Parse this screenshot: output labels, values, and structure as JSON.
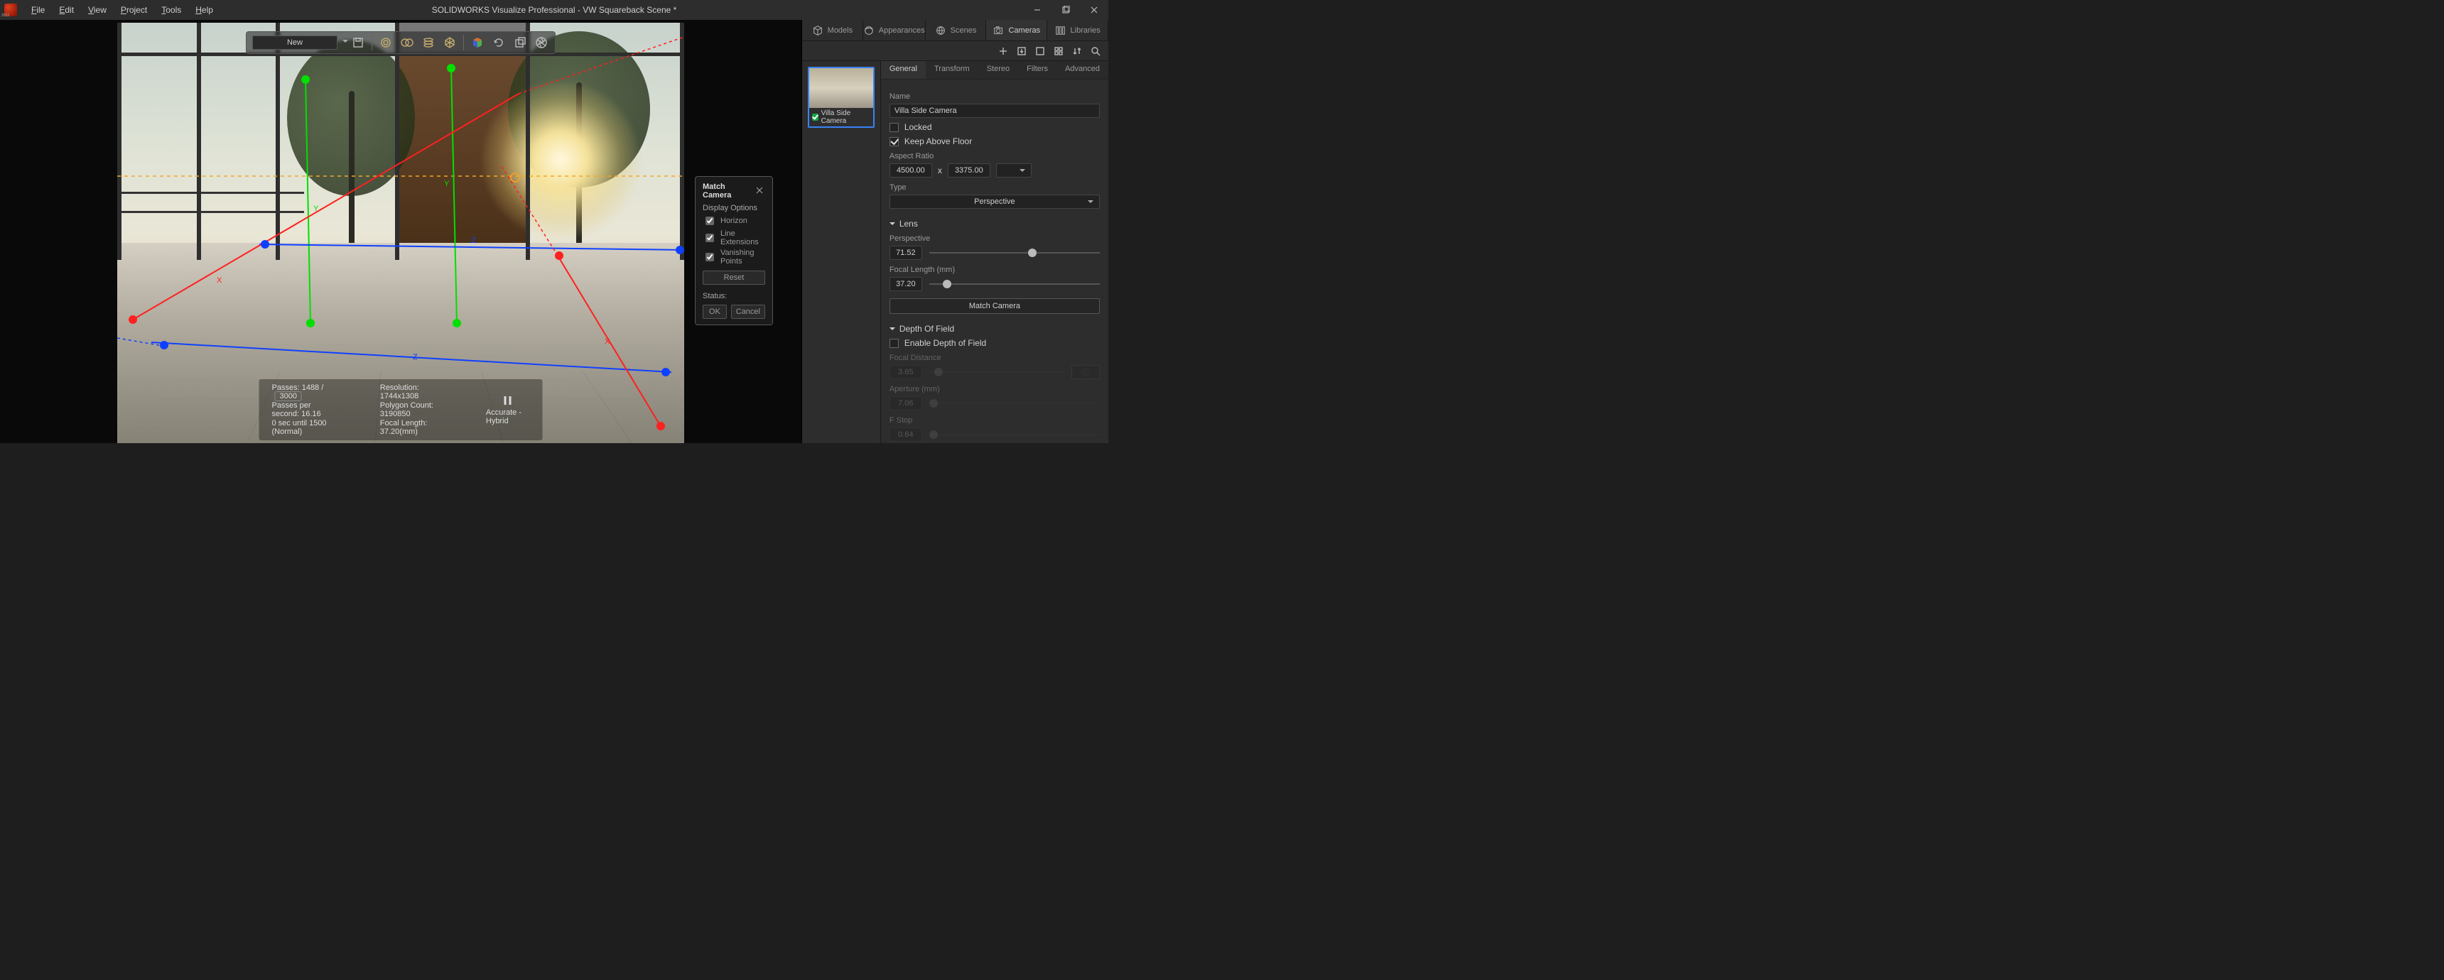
{
  "app_icon_year": "2022",
  "menu": {
    "file": "File",
    "edit": "Edit",
    "view": "View",
    "project": "Project",
    "tools": "Tools",
    "help": "Help"
  },
  "title": "SOLIDWORKS Visualize Professional - VW Squareback Scene *",
  "viewport_toolbar": {
    "camera_preset": "New"
  },
  "match_panel": {
    "title": "Match Camera",
    "display_options": "Display Options",
    "horizon": "Horizon",
    "horizon_on": true,
    "line_ext": "Line Extensions",
    "line_ext_on": true,
    "van_pts": "Vanishing Points",
    "van_pts_on": true,
    "reset": "Reset",
    "status_label": "Status:",
    "status_value": "",
    "ok": "OK",
    "cancel": "Cancel"
  },
  "hud": {
    "passes_label": "Passes:",
    "passes_cur": "1488",
    "passes_sep": "/",
    "passes_max": "3000",
    "pps_label": "Passes per second:",
    "pps_val": "16.16",
    "eta": "0 sec until 1500 (Normal)",
    "res_label": "Resolution:",
    "res_val": "1744x1308",
    "poly_label": "Polygon Count:",
    "poly_val": "3190850",
    "fl_label": "Focal Length:",
    "fl_val": "37.20(mm)",
    "mode": "Accurate - Hybrid"
  },
  "dock_tabs": {
    "models": "Models",
    "appearances": "Appearances",
    "scenes": "Scenes",
    "cameras": "Cameras",
    "libraries": "Libraries"
  },
  "thumb": {
    "name": "Villa Side Camera"
  },
  "prop_tabs": {
    "general": "General",
    "transform": "Transform",
    "stereo": "Stereo",
    "filters": "Filters",
    "advanced": "Advanced"
  },
  "general": {
    "name_label": "Name",
    "name_value": "Villa Side Camera",
    "locked": "Locked",
    "locked_on": false,
    "keep_above": "Keep Above Floor",
    "keep_above_on": true,
    "aspect_label": "Aspect Ratio",
    "aspect_w": "4500.00",
    "aspect_x": "x",
    "aspect_h": "3375.00",
    "type_label": "Type",
    "type_value": "Perspective",
    "lens_hd": "Lens",
    "persp_label": "Perspective",
    "persp_value": "71.52",
    "persp_slider": 0.58,
    "focal_label": "Focal Length (mm)",
    "focal_value": "37.20",
    "focal_slider": 0.08,
    "match_btn": "Match Camera",
    "dof_hd": "Depth Of Field",
    "dof_enable": "Enable Depth of Field",
    "dof_on": false,
    "fd_label": "Focal Distance",
    "fd_value": "3.65",
    "fd_slider": 0.04,
    "pick": "Pick",
    "ap_label": "Aperture (mm)",
    "ap_value": "7.06",
    "ap_slider": 0.0,
    "fstop_label": "F Stop",
    "fstop_value": "0.84",
    "fstop_slider": 0.0
  }
}
